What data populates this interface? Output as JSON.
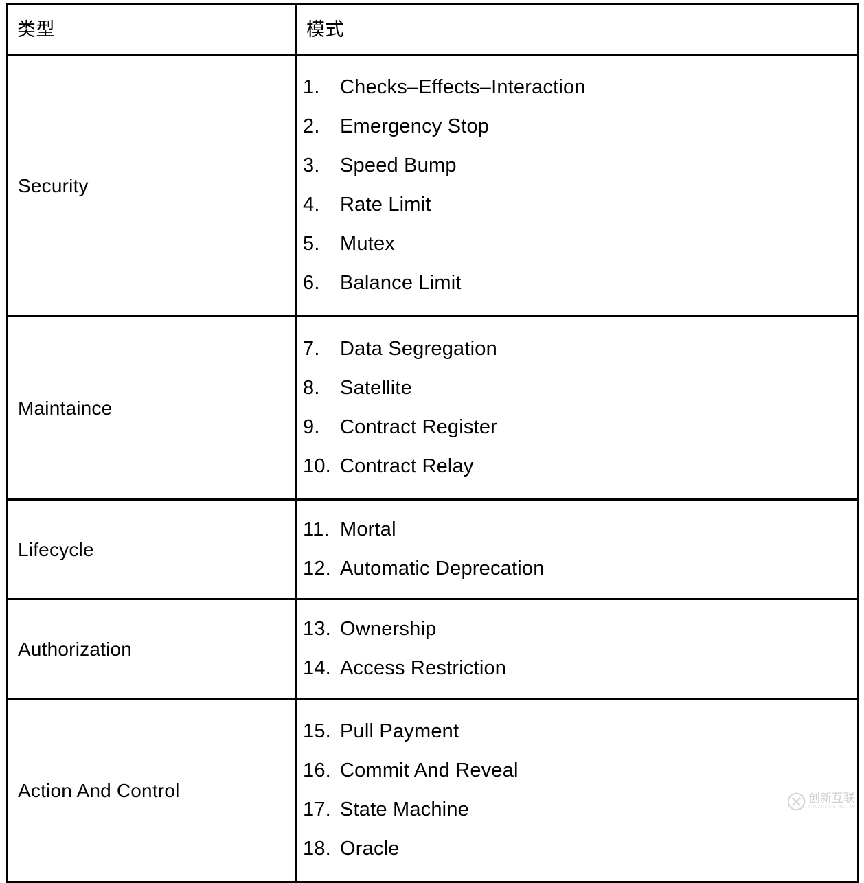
{
  "table": {
    "headers": {
      "type": "类型",
      "mode": "模式"
    },
    "rows": [
      {
        "type": "Security",
        "patterns": [
          {
            "num": "1.",
            "label": "Checks–Effects–Interaction"
          },
          {
            "num": "2.",
            "label": "Emergency Stop"
          },
          {
            "num": "3.",
            "label": "Speed Bump"
          },
          {
            "num": "4.",
            "label": "Rate Limit"
          },
          {
            "num": "5.",
            "label": "Mutex"
          },
          {
            "num": "6.",
            "label": "Balance Limit"
          }
        ]
      },
      {
        "type": "Maintaince",
        "patterns": [
          {
            "num": "7.",
            "label": "Data Segregation"
          },
          {
            "num": "8.",
            "label": "Satellite"
          },
          {
            "num": "9.",
            "label": "Contract Register"
          },
          {
            "num": "10.",
            "label": "Contract Relay"
          }
        ]
      },
      {
        "type": "Lifecycle",
        "patterns": [
          {
            "num": "11.",
            "label": "Mortal"
          },
          {
            "num": "12.",
            "label": "Automatic Deprecation"
          }
        ]
      },
      {
        "type": "Authorization",
        "patterns": [
          {
            "num": "13.",
            "label": "Ownership"
          },
          {
            "num": "14.",
            "label": "Access Restriction"
          }
        ]
      },
      {
        "type": "Action And Control",
        "patterns": [
          {
            "num": "15.",
            "label": "Pull Payment"
          },
          {
            "num": "16.",
            "label": "Commit And Reveal"
          },
          {
            "num": "17.",
            "label": "State Machine"
          },
          {
            "num": "18.",
            "label": "Oracle"
          }
        ]
      }
    ]
  },
  "watermark": {
    "chinese": "创新互联",
    "english": "CHUANGXIN HULIAN",
    "logo_icon": "circle-x-logo-icon"
  },
  "colors": {
    "border": "#000000",
    "text": "#000000",
    "background": "#ffffff",
    "watermark": "#8c8c8c"
  }
}
